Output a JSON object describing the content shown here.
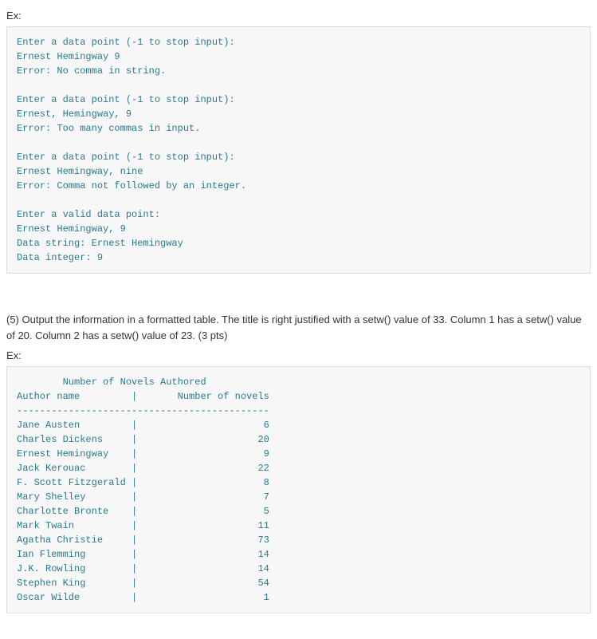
{
  "ex_label": "Ex:",
  "code1": {
    "lines": [
      "Enter a data point (-1 to stop input):",
      "Ernest Hemingway 9",
      "Error: No comma in string.",
      "",
      "Enter a data point (-1 to stop input):",
      "Ernest, Hemingway, 9",
      "Error: Too many commas in input.",
      "",
      "Enter a data point (-1 to stop input):",
      "Ernest Hemingway, nine",
      "Error: Comma not followed by an integer.",
      "",
      "Enter a valid data point:",
      "Ernest Hemingway, 9",
      "Data string: Ernest Hemingway",
      "Data integer: 9"
    ]
  },
  "instruction_text": "(5) Output the information in a formatted table. The title is right justified with a setw() value of 33. Column 1 has a setw() value of 20. Column 2 has a setw() value of 23. (3 pts)",
  "chart_data": {
    "type": "table",
    "title": "Number of Novels Authored",
    "title_setw": 33,
    "col1_setw": 20,
    "col2_setw": 23,
    "columns": [
      "Author name",
      "Number of novels"
    ],
    "rows": [
      {
        "author": "Jane Austen",
        "novels": 6
      },
      {
        "author": "Charles Dickens",
        "novels": 20
      },
      {
        "author": "Ernest Hemingway",
        "novels": 9
      },
      {
        "author": "Jack Kerouac",
        "novels": 22
      },
      {
        "author": "F. Scott Fitzgerald",
        "novels": 8
      },
      {
        "author": "Mary Shelley",
        "novels": 7
      },
      {
        "author": "Charlotte Bronte",
        "novels": 5
      },
      {
        "author": "Mark Twain",
        "novels": 11
      },
      {
        "author": "Agatha Christie",
        "novels": 73
      },
      {
        "author": "Ian Flemming",
        "novels": 14
      },
      {
        "author": "J.K. Rowling",
        "novels": 14
      },
      {
        "author": "Stephen King",
        "novels": 54
      },
      {
        "author": "Oscar Wilde",
        "novels": 1
      }
    ]
  }
}
